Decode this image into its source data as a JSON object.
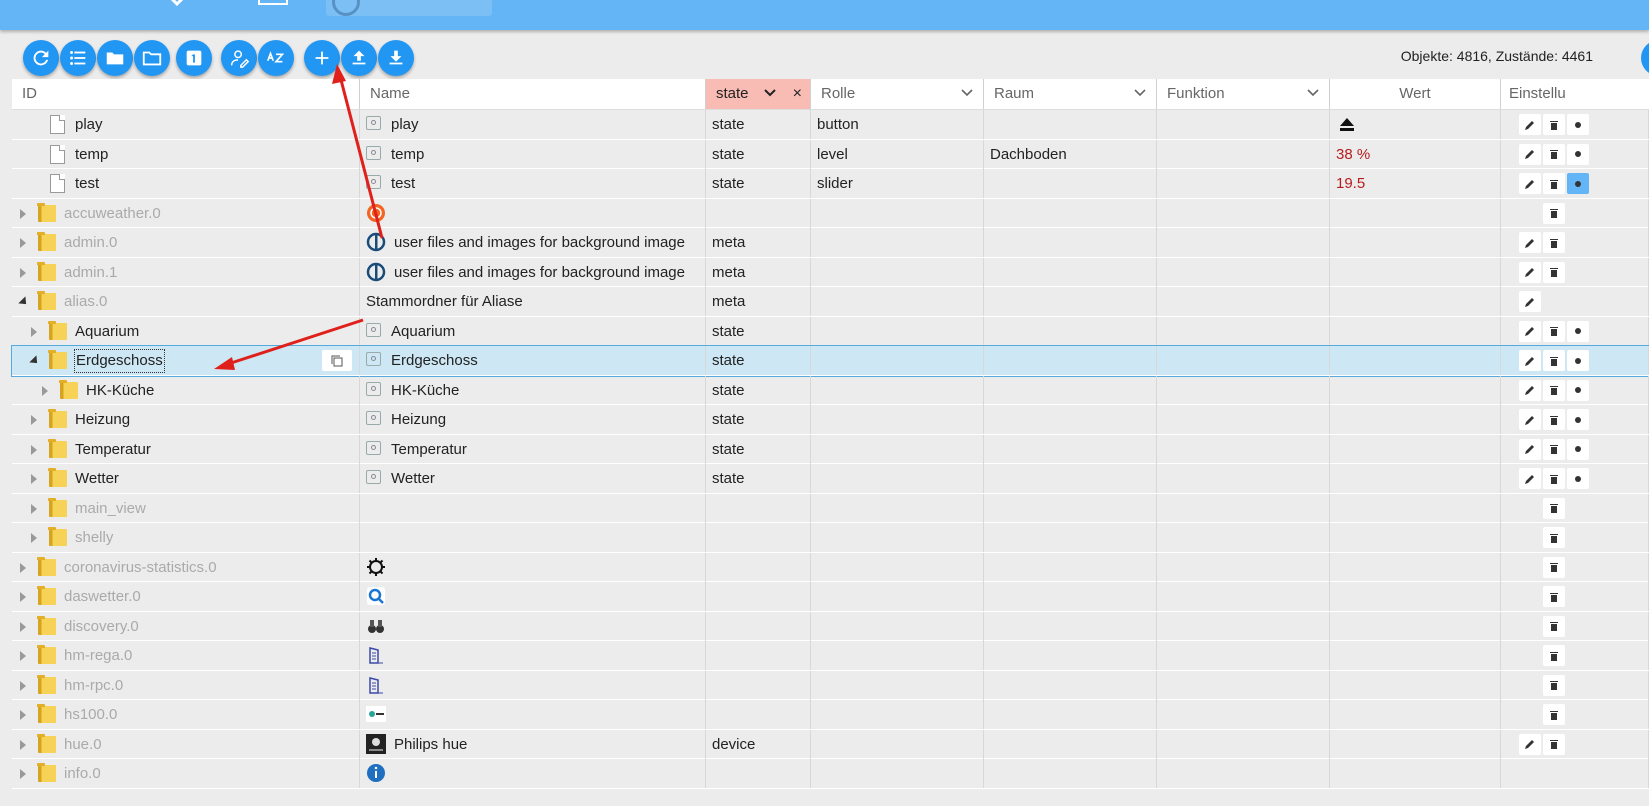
{
  "counts": "Objekte: 4816, Zustände: 4461",
  "toolbar": [
    {
      "icon": "refresh-icon"
    },
    {
      "icon": "list-icon"
    },
    {
      "icon": "folder-icon"
    },
    {
      "icon": "folder-open-icon"
    },
    {
      "icon": "number-one-icon"
    },
    {
      "icon": "user-edit-icon"
    },
    {
      "icon": "sort-az-icon"
    },
    {
      "icon": "add-icon"
    },
    {
      "icon": "upload-icon"
    },
    {
      "icon": "download-icon"
    }
  ],
  "header": {
    "id": "ID",
    "name": "Name",
    "type_filter": "state",
    "role": "Rolle",
    "room": "Raum",
    "function": "Funktion",
    "value": "Wert",
    "settings": "Einstellu"
  },
  "colors": {
    "accent": "#2196f3",
    "topbar": "#64b5f6",
    "selected": "#cde7f5",
    "filter": "#f8bcb4",
    "value": "#b71c1c"
  },
  "rows": [
    {
      "id": "play",
      "name": "play",
      "type": "state",
      "role": "button",
      "room": "",
      "value": ""
    },
    {
      "id": "temp",
      "name": "temp",
      "type": "state",
      "role": "level",
      "room": "Dachboden",
      "value": "38 %"
    },
    {
      "id": "test",
      "name": "test",
      "type": "state",
      "role": "slider",
      "room": "",
      "value": "19.5"
    },
    {
      "id": "accuweather.0",
      "name": "",
      "type": "",
      "role": "",
      "room": "",
      "value": ""
    },
    {
      "id": "admin.0",
      "name": "user files and images for background image",
      "type": "meta",
      "role": "",
      "room": "",
      "value": ""
    },
    {
      "id": "admin.1",
      "name": "user files and images for background image",
      "type": "meta",
      "role": "",
      "room": "",
      "value": ""
    },
    {
      "id": "alias.0",
      "name": "Stammordner für Aliase",
      "type": "meta",
      "role": "",
      "room": "",
      "value": ""
    },
    {
      "id": "Aquarium",
      "name": "Aquarium",
      "type": "state",
      "role": "",
      "room": "",
      "value": ""
    },
    {
      "id": "Erdgeschoss",
      "name": "Erdgeschoss",
      "type": "state",
      "role": "",
      "room": "",
      "value": ""
    },
    {
      "id": "HK-Küche",
      "name": "HK-Küche",
      "type": "state",
      "role": "",
      "room": "",
      "value": ""
    },
    {
      "id": "Heizung",
      "name": "Heizung",
      "type": "state",
      "role": "",
      "room": "",
      "value": ""
    },
    {
      "id": "Temperatur",
      "name": "Temperatur",
      "type": "state",
      "role": "",
      "room": "",
      "value": ""
    },
    {
      "id": "Wetter",
      "name": "Wetter",
      "type": "state",
      "role": "",
      "room": "",
      "value": ""
    },
    {
      "id": "main_view",
      "name": "",
      "type": "",
      "role": "",
      "room": "",
      "value": ""
    },
    {
      "id": "shelly",
      "name": "",
      "type": "",
      "role": "",
      "room": "",
      "value": ""
    },
    {
      "id": "coronavirus-statistics.0",
      "name": "",
      "type": "",
      "role": "",
      "room": "",
      "value": ""
    },
    {
      "id": "daswetter.0",
      "name": "",
      "type": "",
      "role": "",
      "room": "",
      "value": ""
    },
    {
      "id": "discovery.0",
      "name": "",
      "type": "",
      "role": "",
      "room": "",
      "value": ""
    },
    {
      "id": "hm-rega.0",
      "name": "",
      "type": "",
      "role": "",
      "room": "",
      "value": ""
    },
    {
      "id": "hm-rpc.0",
      "name": "",
      "type": "",
      "role": "",
      "room": "",
      "value": ""
    },
    {
      "id": "hs100.0",
      "name": "",
      "type": "",
      "role": "",
      "room": "",
      "value": ""
    },
    {
      "id": "hue.0",
      "name": "Philips hue",
      "type": "device",
      "role": "",
      "room": "",
      "value": ""
    },
    {
      "id": "info.0",
      "name": "",
      "type": "",
      "role": "",
      "room": "",
      "value": ""
    }
  ]
}
